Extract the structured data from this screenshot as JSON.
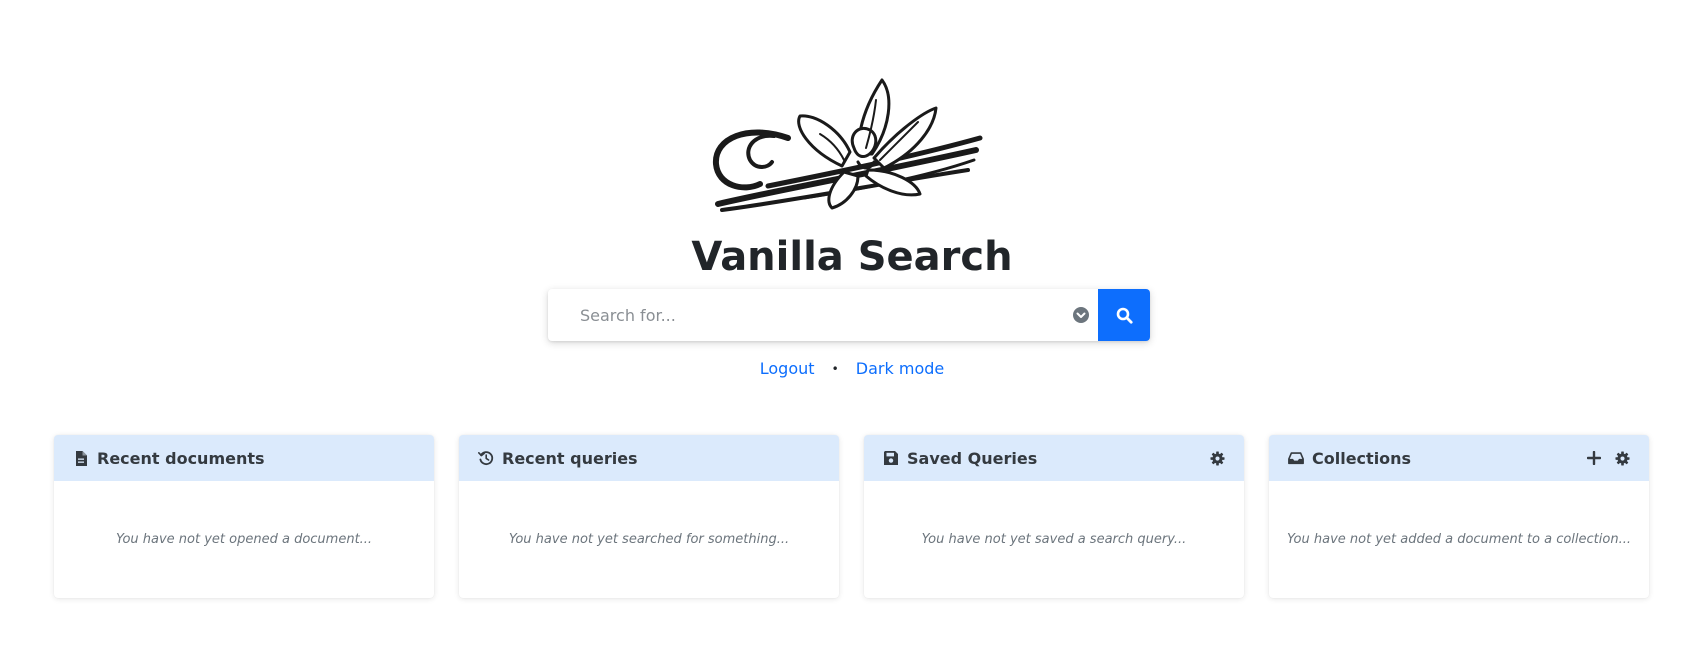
{
  "app": {
    "title": "Vanilla Search",
    "logo_icon": "vanilla-flower-logo"
  },
  "search": {
    "placeholder": "Search for...",
    "value": "",
    "dropdown_icon": "chevron-circle-down-icon",
    "button_icon": "search-icon",
    "accent_color": "#0d6efd"
  },
  "links": {
    "logout": "Logout",
    "separator": "•",
    "dark_mode": "Dark mode"
  },
  "cards": [
    {
      "title": "Recent documents",
      "icon": "file-icon",
      "empty_text": "You have not yet opened a document..."
    },
    {
      "title": "Recent queries",
      "icon": "history-icon",
      "empty_text": "You have not yet searched for something..."
    },
    {
      "title": "Saved Queries",
      "icon": "save-icon",
      "actions": [
        "gear-icon"
      ],
      "empty_text": "You have not yet saved a search query..."
    },
    {
      "title": "Collections",
      "icon": "inbox-icon",
      "actions": [
        "plus-icon",
        "gear-icon"
      ],
      "empty_text": "You have not yet added a document to a collection..."
    }
  ],
  "colors": {
    "card_header_bg": "#dbeafc",
    "link": "#0d6efd"
  }
}
